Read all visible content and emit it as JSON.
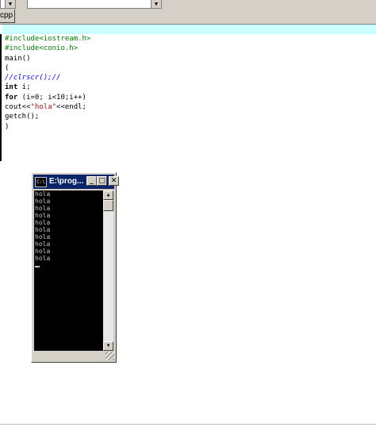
{
  "tab": {
    "label": "cpp"
  },
  "editor": {
    "lines": [
      [
        {
          "t": "#include<iostream.h>",
          "c": "pp"
        }
      ],
      [
        {
          "t": "#include<conio.h>",
          "c": "pp"
        }
      ],
      [
        {
          "t": "main()",
          "c": ""
        }
      ],
      [
        {
          "t": "(",
          "c": ""
        }
      ],
      [
        {
          "t": "//clrscr();//",
          "c": "cm"
        }
      ],
      [
        {
          "t": "int",
          "c": "kw"
        },
        {
          "t": " i;",
          "c": ""
        }
      ],
      [
        {
          "t": "for",
          "c": "kw"
        },
        {
          "t": " (i=0; i<10;i++)",
          "c": ""
        }
      ],
      [
        {
          "t": "cout<<",
          "c": ""
        },
        {
          "t": "\"hola\"",
          "c": "st"
        },
        {
          "t": "<<endl;",
          "c": ""
        }
      ],
      [
        {
          "t": "getch();",
          "c": ""
        }
      ],
      [
        {
          "t": ")",
          "c": ""
        }
      ]
    ]
  },
  "console": {
    "title": "E:\\prog...",
    "icon_text": "C:\\",
    "output": [
      "hola",
      "hola",
      "hola",
      "hola",
      "hola",
      "hola",
      "hola",
      "hola",
      "hola",
      "hola"
    ],
    "buttons": {
      "minimize": "_",
      "maximize": "□",
      "close": "✕"
    },
    "scroll": {
      "up": "▲",
      "down": "▼"
    }
  },
  "toolbar": {
    "dropdown_arrow": "▼"
  }
}
